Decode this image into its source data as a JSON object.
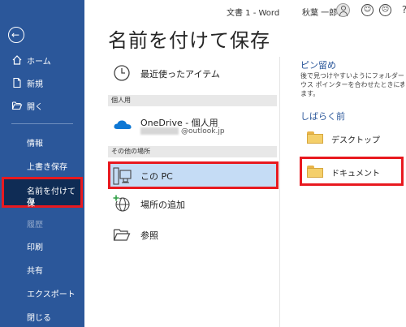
{
  "titlebar": {
    "document": "文書 1  -  Word",
    "user": "秋葉 一郎"
  },
  "sidebar": {
    "nav": [
      {
        "label": "ホーム",
        "icon": "home-icon"
      },
      {
        "label": "新規",
        "icon": "new-document-icon"
      },
      {
        "label": "開く",
        "icon": "open-folder-icon"
      }
    ],
    "items": [
      {
        "label": "情報",
        "dim": false
      },
      {
        "label": "上書き保存",
        "dim": false
      },
      {
        "label": "名前を付けて保存",
        "line1": "名前を付けて保",
        "line2": "存",
        "active": true
      },
      {
        "label": "履歴",
        "dim": true
      },
      {
        "label": "印刷",
        "dim": false
      },
      {
        "label": "共有",
        "dim": false
      },
      {
        "label": "エクスポート",
        "dim": false
      },
      {
        "label": "閉じる",
        "dim": false
      }
    ]
  },
  "main": {
    "title": "名前を付けて保存",
    "locations": {
      "recent": "最近使ったアイテム",
      "personal_header": "個人用",
      "onedrive": "OneDrive - 個人用",
      "onedrive_account": "@outlook.jp",
      "other_header": "その他の場所",
      "this_pc": "この PC",
      "add_place": "場所の追加",
      "browse": "参照"
    }
  },
  "right": {
    "pinned_title": "ピン留め",
    "pinned_desc_lines": [
      "後で見つけやすいようにフォルダーをピン",
      "ウス ポインターを合わせたときに表示さ",
      "ます。"
    ],
    "recent_title": "しばらく前",
    "folders": [
      "デスクトップ",
      "ドキュメント"
    ]
  },
  "colors": {
    "sidebar": "#2b579a",
    "active_item": "#0f2c55",
    "highlight_border": "#e8191f",
    "selected_bg": "#c5dcf5",
    "accent_text": "#2b579a"
  }
}
